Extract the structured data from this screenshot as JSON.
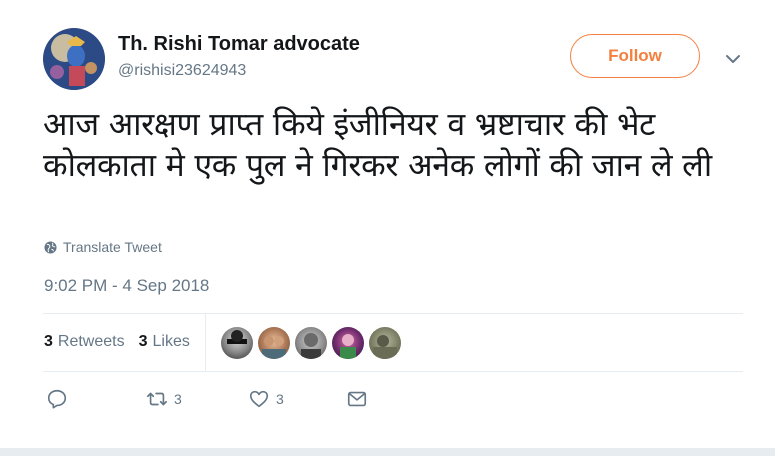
{
  "author": {
    "display_name": "Th. Rishi Tomar advocate",
    "handle": "@rishisi23624943",
    "avatar_icon": "profile-avatar"
  },
  "follow_button": {
    "label": "Follow",
    "color": "#f3803f"
  },
  "more_menu": {
    "icon": "chevron-down-icon"
  },
  "tweet": {
    "text": "आज आरक्षण प्राप्त किये इंजीनियर व भ्रष्टाचार की भेट कोलकाता मे एक पुल ने गिरकर अनेक लोगों की जान ले ली",
    "translate_label": "Translate Tweet",
    "timestamp": "9:02 PM - 4 Sep 2018"
  },
  "stats": {
    "retweets_count": "3",
    "retweets_label": "Retweets",
    "likes_count": "3",
    "likes_label": "Likes"
  },
  "actions": {
    "reply_count": "",
    "retweet_count": "3",
    "like_count": "3"
  }
}
